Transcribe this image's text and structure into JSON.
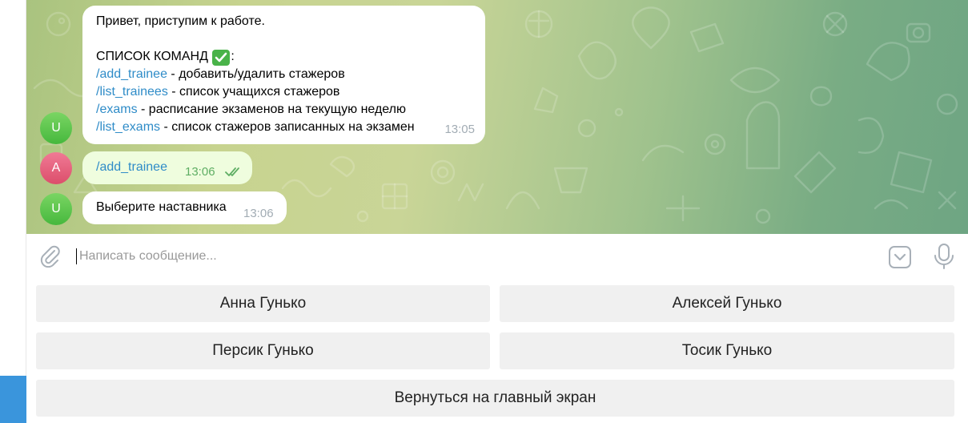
{
  "colors": {
    "accent": "#3a95dc",
    "link": "#2f8cc8",
    "bubble_in": "#ffffff",
    "bubble_out": "#effdde",
    "time_out": "#5fae64",
    "avatar_bot": "#4cbb42",
    "avatar_user": "#e2607c",
    "keyboard_button": "#f0f0f0"
  },
  "messages": [
    {
      "from": "bot",
      "avatar_letter": "U",
      "greeting": "Привет, приступим к работе.",
      "commands_title": "СПИСОК КОМАНД",
      "commands_title_emoji": "white-check-mark-icon",
      "commands_title_suffix": ":",
      "commands": [
        {
          "cmd": "/add_trainee",
          "desc": " - добавить/удалить стажеров"
        },
        {
          "cmd": "/list_trainees",
          "desc": " - список учащихся стажеров"
        },
        {
          "cmd": "/exams",
          "desc": " - расписание экзаменов на текущую неделю"
        },
        {
          "cmd": "/list_exams",
          "desc": " - список стажеров записанных на экзамен"
        }
      ],
      "time": "13:05"
    },
    {
      "from": "user",
      "avatar_letter": "A",
      "text": "/add_trainee",
      "time": "13:06",
      "status_icon": "double-check-read-icon"
    },
    {
      "from": "bot",
      "avatar_letter": "U",
      "text": "Выберите наставника",
      "time": "13:06"
    }
  ],
  "composer": {
    "attach_icon": "paperclip-icon",
    "placeholder": "Написать сообщение...",
    "value": "",
    "keyboard_toggle_icon": "keyboard-hide-icon",
    "mic_icon": "microphone-icon"
  },
  "keyboard": {
    "buttons": [
      "Анна Гунько",
      "Алексей Гунько",
      "Персик Гунько",
      "Тосик Гунько",
      "Вернуться на главный экран"
    ]
  }
}
